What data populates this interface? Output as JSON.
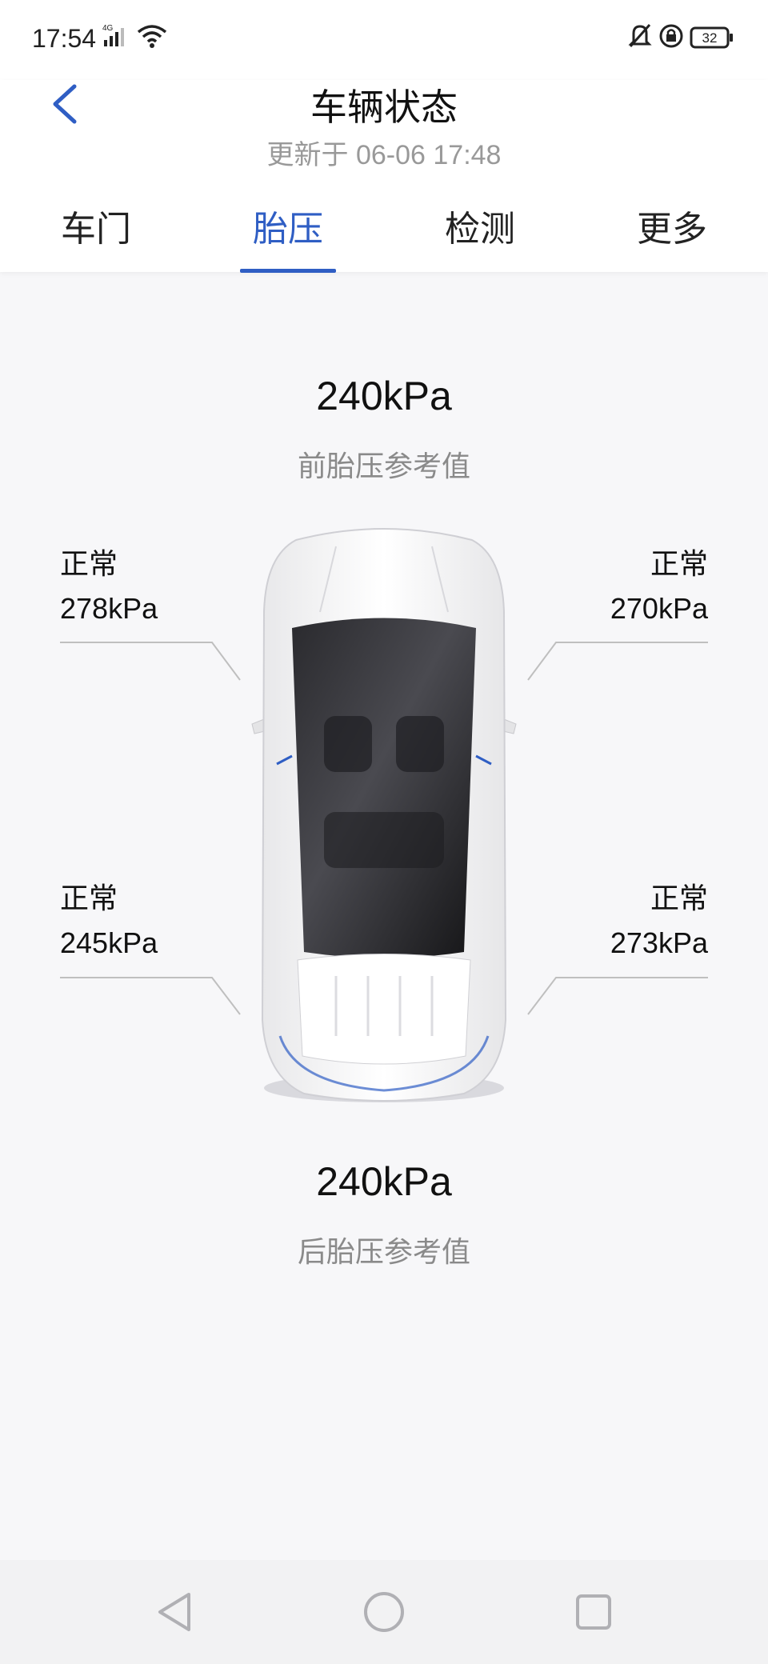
{
  "status_bar": {
    "time": "17:54",
    "network": "4G",
    "battery": "32",
    "icons": [
      "signal-icon",
      "wifi-icon",
      "bell-off-icon",
      "rotation-lock-icon",
      "battery-icon"
    ]
  },
  "header": {
    "title": "车辆状态",
    "subtitle": "更新于 06-06 17:48",
    "back_icon": "back-arrow-icon"
  },
  "tabs": [
    {
      "label": "车门",
      "active": false
    },
    {
      "label": "胎压",
      "active": true
    },
    {
      "label": "检测",
      "active": false
    },
    {
      "label": "更多",
      "active": false
    }
  ],
  "front_reference": {
    "value": "240kPa",
    "label": "前胎压参考值"
  },
  "rear_reference": {
    "value": "240kPa",
    "label": "后胎压参考值"
  },
  "tires": {
    "front_left": {
      "status": "正常",
      "pressure": "278kPa"
    },
    "front_right": {
      "status": "正常",
      "pressure": "270kPa"
    },
    "rear_left": {
      "status": "正常",
      "pressure": "245kPa"
    },
    "rear_right": {
      "status": "正常",
      "pressure": "273kPa"
    }
  },
  "colors": {
    "accent": "#2f5ec4",
    "tire_highlight": "#3a6fd1",
    "secondary_text": "#999999"
  },
  "nav_bar": {
    "icons": [
      "back-triangle-icon",
      "home-circle-icon",
      "recents-square-icon"
    ]
  }
}
